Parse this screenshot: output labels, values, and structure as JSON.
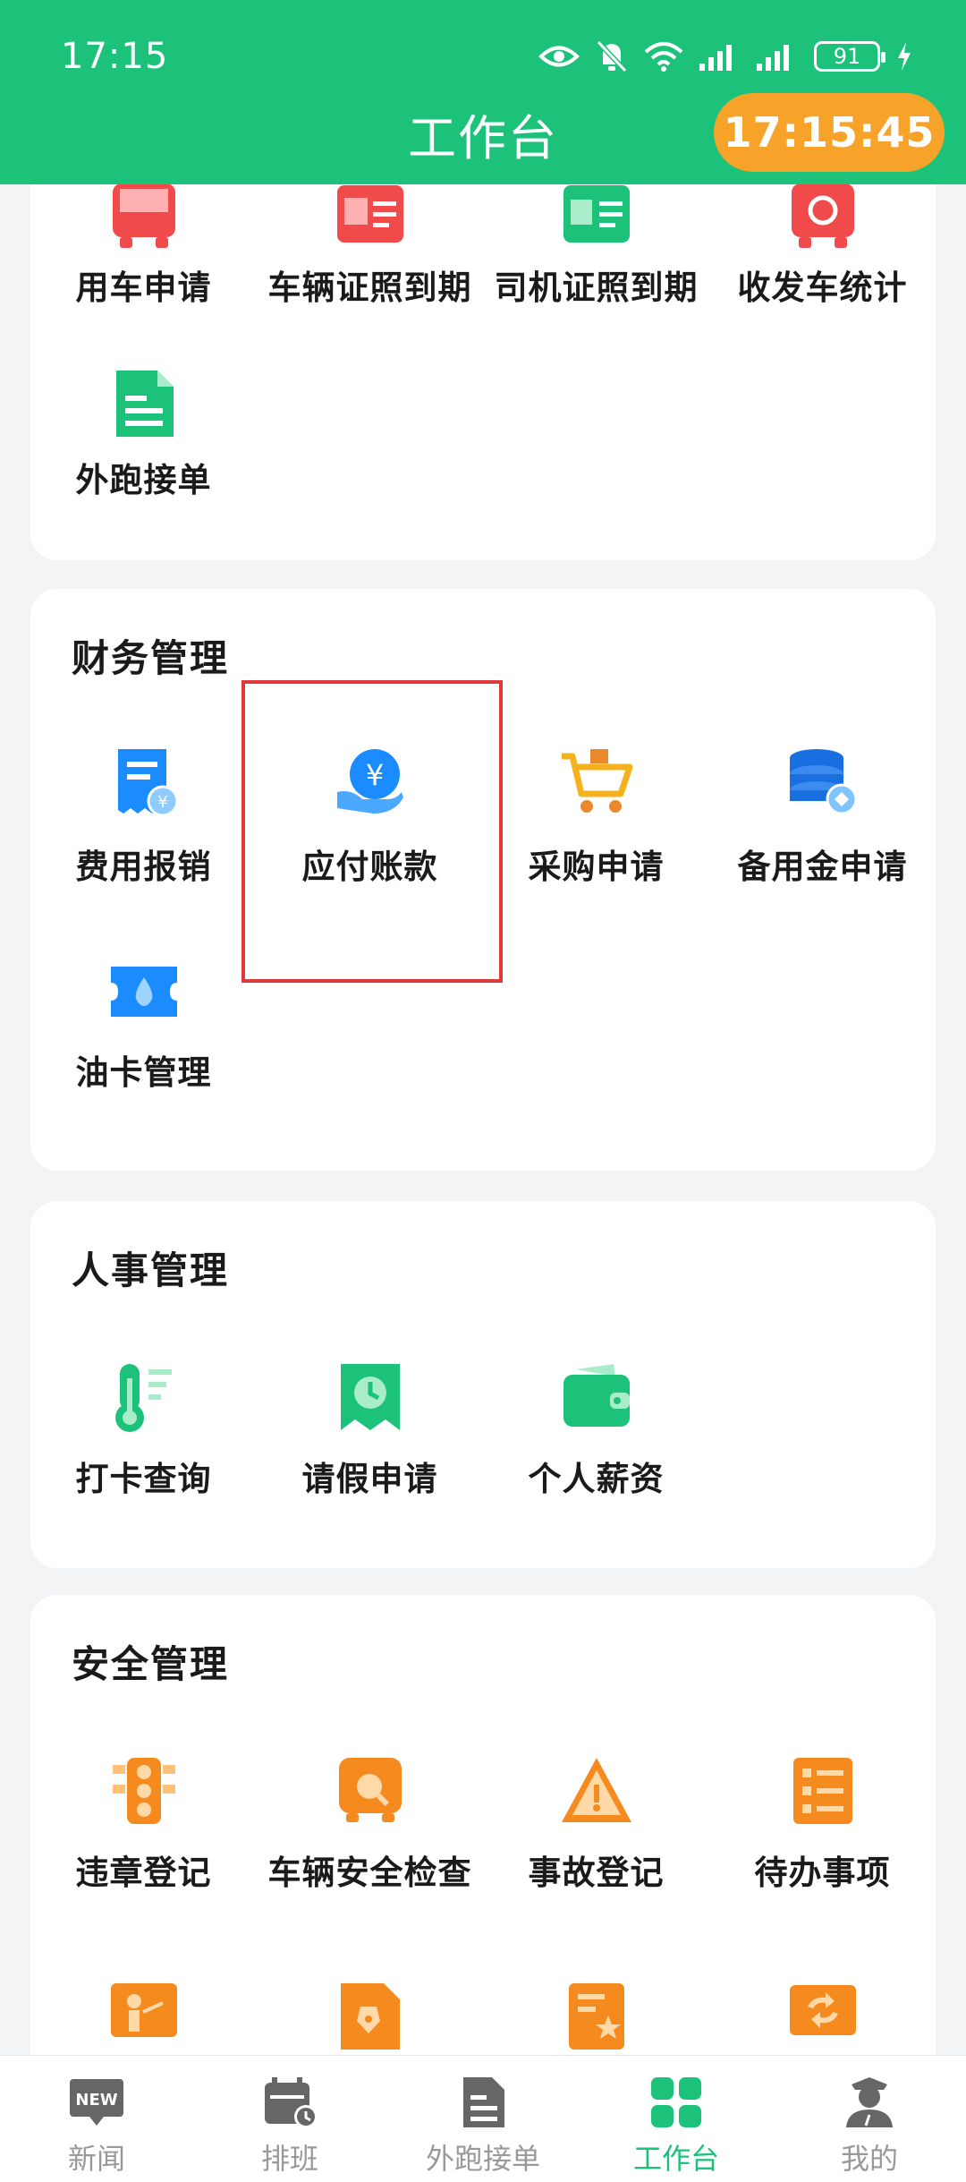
{
  "status_bar": {
    "time": "17:15",
    "battery": "91"
  },
  "header": {
    "title": "工作台",
    "clock": "17:15:45"
  },
  "sections": {
    "vehicle": {
      "items": [
        {
          "label": "用车申请",
          "icon": "bus-request-icon"
        },
        {
          "label": "车辆证照到期",
          "icon": "vehicle-license-icon"
        },
        {
          "label": "司机证照到期",
          "icon": "driver-license-icon"
        },
        {
          "label": "收发车统计",
          "icon": "dispatch-stats-icon"
        },
        {
          "label": "外跑接单",
          "icon": "document-icon"
        }
      ]
    },
    "finance": {
      "title": "财务管理",
      "items": [
        {
          "label": "费用报销",
          "icon": "receipt-yen-icon"
        },
        {
          "label": "应付账款",
          "icon": "hand-yen-icon"
        },
        {
          "label": "采购申请",
          "icon": "shopping-cart-icon"
        },
        {
          "label": "备用金申请",
          "icon": "coin-stack-icon"
        },
        {
          "label": "油卡管理",
          "icon": "fuel-card-icon"
        }
      ]
    },
    "hr": {
      "title": "人事管理",
      "items": [
        {
          "label": "打卡查询",
          "icon": "thermometer-icon"
        },
        {
          "label": "请假申请",
          "icon": "clock-flag-icon"
        },
        {
          "label": "个人薪资",
          "icon": "wallet-icon"
        }
      ]
    },
    "safety": {
      "title": "安全管理",
      "items": [
        {
          "label": "违章登记",
          "icon": "traffic-light-icon"
        },
        {
          "label": "车辆安全检查",
          "icon": "bus-inspect-icon"
        },
        {
          "label": "事故登记",
          "icon": "warning-triangle-icon"
        },
        {
          "label": "待办事项",
          "icon": "checklist-icon"
        }
      ]
    }
  },
  "bottom_nav": [
    {
      "label": "新闻",
      "badge": "NEW",
      "icon": "news-icon",
      "active": false
    },
    {
      "label": "排班",
      "icon": "calendar-clock-icon",
      "active": false
    },
    {
      "label": "外跑接单",
      "icon": "order-doc-icon",
      "active": false
    },
    {
      "label": "工作台",
      "icon": "grid-icon",
      "active": true
    },
    {
      "label": "我的",
      "icon": "user-icon",
      "active": false
    }
  ],
  "colors": {
    "primary": "#1cc27a",
    "accent": "#f7a32a",
    "highlight": "#e0393b",
    "blue": "#1a8cff",
    "orange": "#f58a1f"
  }
}
